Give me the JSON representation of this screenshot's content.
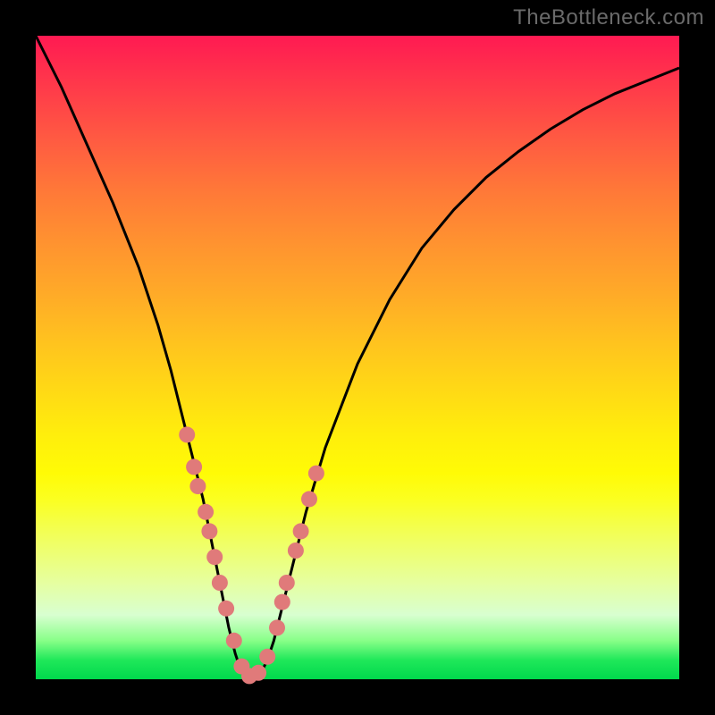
{
  "watermark": "TheBottleneck.com",
  "chart_data": {
    "type": "line",
    "title": "",
    "xlabel": "",
    "ylabel": "",
    "xlim": [
      0,
      100
    ],
    "ylim": [
      0,
      100
    ],
    "x": [
      0,
      4,
      8,
      12,
      16,
      19,
      21,
      23,
      24.5,
      26,
      27,
      28,
      29,
      30,
      31,
      32,
      33,
      34,
      35,
      36,
      37,
      38,
      40,
      42,
      45,
      50,
      55,
      60,
      65,
      70,
      75,
      80,
      85,
      90,
      95,
      100
    ],
    "values": [
      100,
      92,
      83,
      74,
      64,
      55,
      48,
      40,
      34,
      28,
      23,
      18,
      13,
      8,
      4,
      1,
      0,
      0,
      1,
      3,
      6,
      10,
      18,
      26,
      36,
      49,
      59,
      67,
      73,
      78,
      82,
      85.5,
      88.5,
      91,
      93,
      95
    ],
    "markers_x": [
      23.5,
      24.6,
      25.2,
      26.4,
      27.0,
      27.8,
      28.6,
      29.6,
      30.8,
      32.0,
      33.2,
      34.6,
      36.0,
      37.5,
      38.3,
      39.0,
      40.4,
      41.2,
      42.5,
      43.6
    ],
    "markers_y": [
      38,
      33,
      30,
      26,
      23,
      19,
      15,
      11,
      6,
      2,
      0.5,
      1,
      3.5,
      8,
      12,
      15,
      20,
      23,
      28,
      32
    ],
    "marker_color": "#e07a7a",
    "curve_color": "#000000"
  }
}
